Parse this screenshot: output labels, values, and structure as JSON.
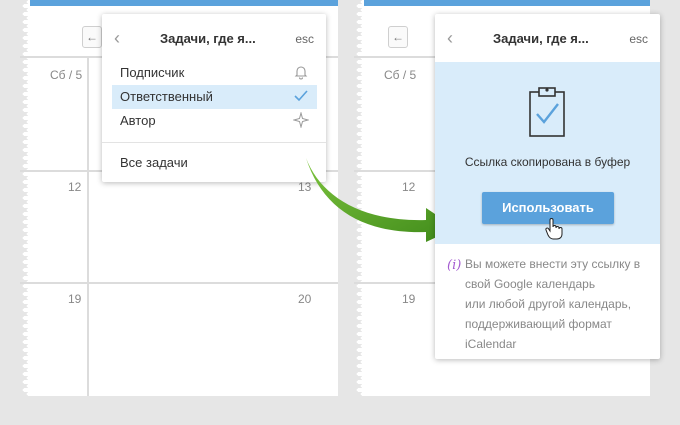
{
  "left_panel": {
    "day_header": "Сб / 5",
    "cells": [
      {
        "num": "12"
      },
      {
        "num": "13"
      },
      {
        "num": "19"
      },
      {
        "num": "20"
      }
    ]
  },
  "right_panel": {
    "day_header": "Сб / 5",
    "cells": [
      {
        "num": "12"
      },
      {
        "num": "19"
      }
    ]
  },
  "menu_popup": {
    "title": "Задачи, где я...",
    "esc": "esc",
    "items": [
      {
        "label": "Подписчик",
        "icon": "bell-icon",
        "selected": false
      },
      {
        "label": "Ответственный",
        "icon": "checkmark-icon",
        "selected": true
      },
      {
        "label": "Автор",
        "icon": "sparkle-icon",
        "selected": false
      }
    ],
    "all_tasks": "Все задачи"
  },
  "confirm_popup": {
    "title": "Задачи, где я...",
    "esc": "esc",
    "copied_text": "Ссылка скопирована в буфер",
    "use_button": "Использовать",
    "info_lines": [
      "Вы можете внести эту ссылку в",
      "свой Google календарь",
      "или любой другой календарь,",
      "поддерживающий формат",
      "iCalendar"
    ]
  },
  "colors": {
    "accent": "#5ba2dc",
    "highlight": "#d9ecfa",
    "arrow": "#5aa52a",
    "info_icon": "#a45cd1"
  }
}
